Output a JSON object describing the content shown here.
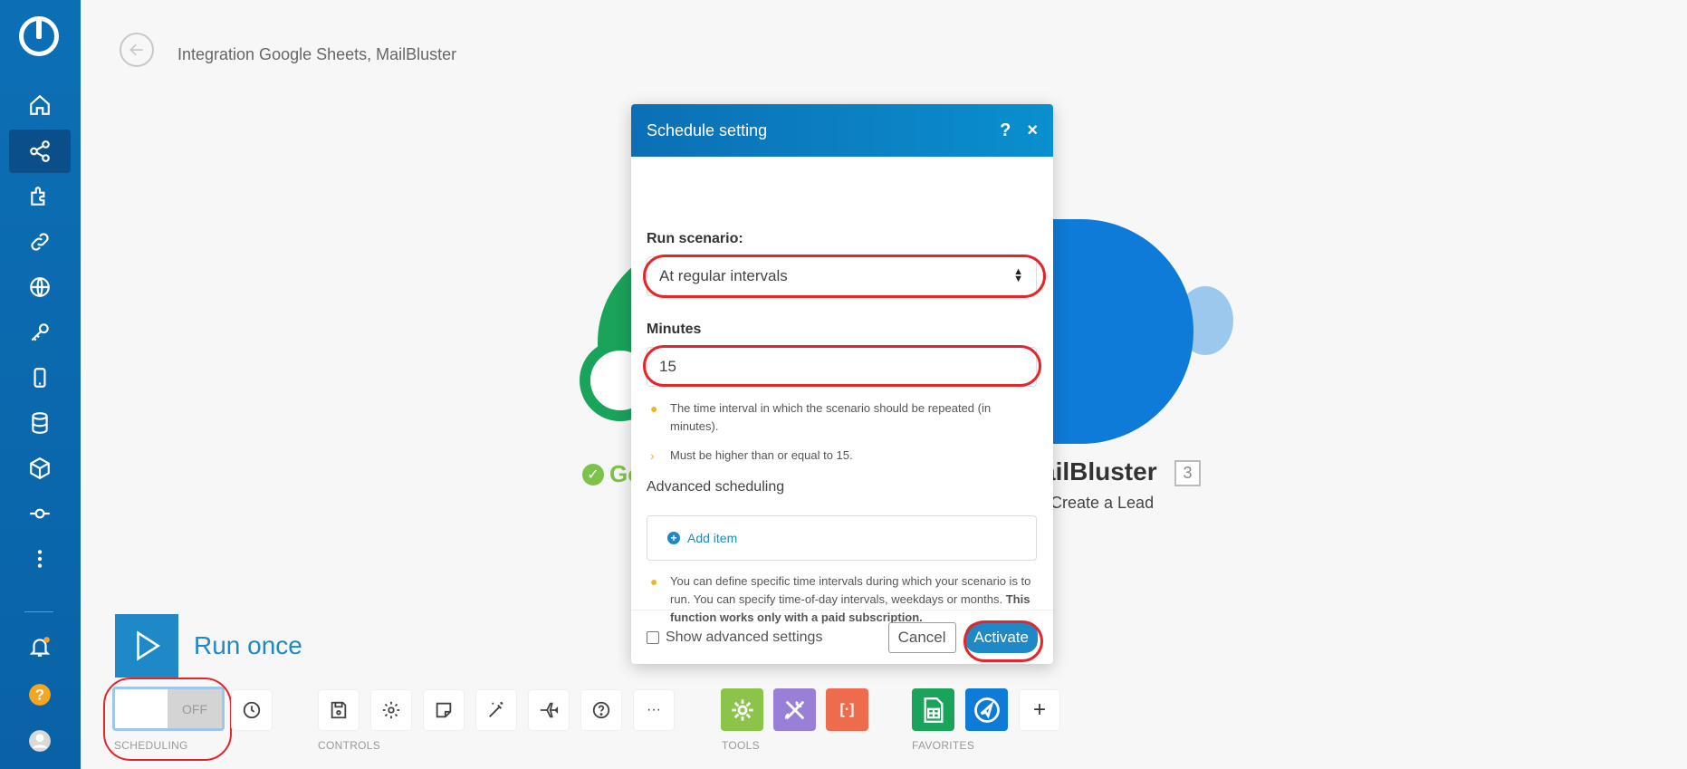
{
  "header": {
    "title": "Integration Google Sheets, MailBluster"
  },
  "canvas": {
    "left_module": {
      "label": "Go"
    },
    "right_module": {
      "label": "ailBluster",
      "badge": "3",
      "subtitle": "Create a Lead"
    }
  },
  "toolbar": {
    "run_once": "Run once",
    "scheduling_state": "OFF",
    "captions": {
      "scheduling": "SCHEDULING",
      "controls": "CONTROLS",
      "tools": "TOOLS",
      "favorites": "FAVORITES"
    },
    "more": "···",
    "tools": {
      "text_parser": "[·]"
    },
    "add": "+"
  },
  "modal": {
    "title": "Schedule setting",
    "help": "?",
    "close": "×",
    "run_scenario_label": "Run scenario:",
    "run_scenario_value": "At regular intervals",
    "minutes_label": "Minutes",
    "minutes_value": "15",
    "hint_interval": "The time interval in which the scenario should be repeated (in minutes).",
    "hint_min": "Must be higher than or equal to 15.",
    "advanced_title": "Advanced scheduling",
    "add_item": "Add item",
    "hint_advanced": "You can define specific time intervals during which your scenario is to run. You can specify time-of-day intervals, weekdays or months.",
    "hint_advanced_bold": "This function works only with a paid subscription.",
    "show_advanced": "Show advanced settings",
    "cancel": "Cancel",
    "activate": "Activate"
  },
  "colors": {
    "brand": "#0c6fb5",
    "accent": "#1f88c7",
    "highlight": "#e4262b"
  }
}
